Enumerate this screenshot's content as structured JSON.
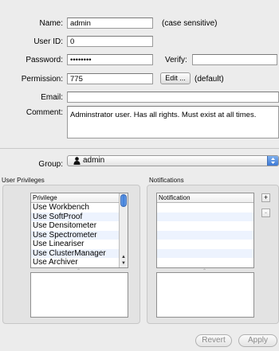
{
  "form": {
    "name_label": "Name:",
    "name_value": "admin",
    "name_hint": "(case sensitive)",
    "userid_label": "User ID:",
    "userid_value": "0",
    "password_label": "Password:",
    "password_value": "••••••••",
    "verify_label": "Verify:",
    "verify_value": "",
    "permission_label": "Permission:",
    "permission_value": "775",
    "edit_button": "Edit ...",
    "permission_hint": "(default)",
    "email_label": "Email:",
    "email_value": "",
    "comment_label": "Comment:",
    "comment_value": "Adminstrator user.  Has all rights.  Must exist at all times."
  },
  "group": {
    "label": "Group:",
    "selected": "admin",
    "icon": "user-silhouette-icon"
  },
  "privileges": {
    "section_title": "User Privileges",
    "column_header": "Privilege",
    "items": [
      "Use Workbench",
      "Use SoftProof",
      "Use Densitometer",
      "Use Spectrometer",
      "Use Lineariser",
      "Use ClusterManager",
      "Use Archiver"
    ]
  },
  "notifications": {
    "section_title": "Notifications",
    "column_header": "Notification",
    "add_label": "+",
    "remove_label": "-"
  },
  "footer": {
    "revert_label": "Revert",
    "apply_label": "Apply"
  },
  "colors": {
    "window_bg": "#ececec",
    "stripe": "#edf3fe",
    "scroll_thumb": "#3d7dd9"
  }
}
